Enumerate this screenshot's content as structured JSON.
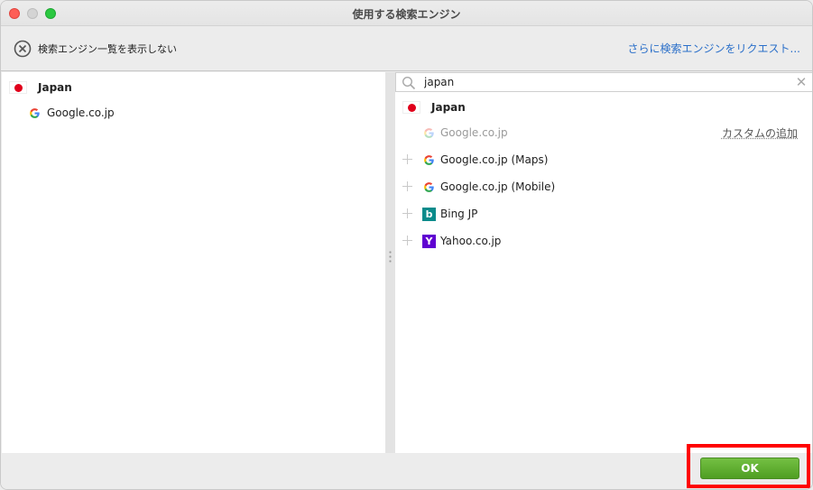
{
  "window": {
    "title": "使用する検索エンジン"
  },
  "toolbar": {
    "hide_list_label": "検索エンジン一覧を表示しない",
    "request_link": "さらに検索エンジンをリクエスト..."
  },
  "left": {
    "group_label": "Japan",
    "items": [
      {
        "label": "Google.co.jp",
        "icon": "google-icon"
      }
    ]
  },
  "right": {
    "search": {
      "value": "japan",
      "placeholder": ""
    },
    "group_label": "Japan",
    "selected_item": {
      "label": "Google.co.jp",
      "action": "カスタムの追加"
    },
    "items": [
      {
        "label": "Google.co.jp (Maps)",
        "icon": "google-icon"
      },
      {
        "label": "Google.co.jp (Mobile)",
        "icon": "google-icon"
      },
      {
        "label": "Bing JP",
        "icon": "bing-icon"
      },
      {
        "label": "Yahoo.co.jp",
        "icon": "yahoo-icon"
      }
    ]
  },
  "footer": {
    "ok_label": "OK"
  },
  "colors": {
    "accent_link": "#2a6fc9",
    "ok_button": "#5fae2f",
    "highlight_border": "#ff0000"
  }
}
